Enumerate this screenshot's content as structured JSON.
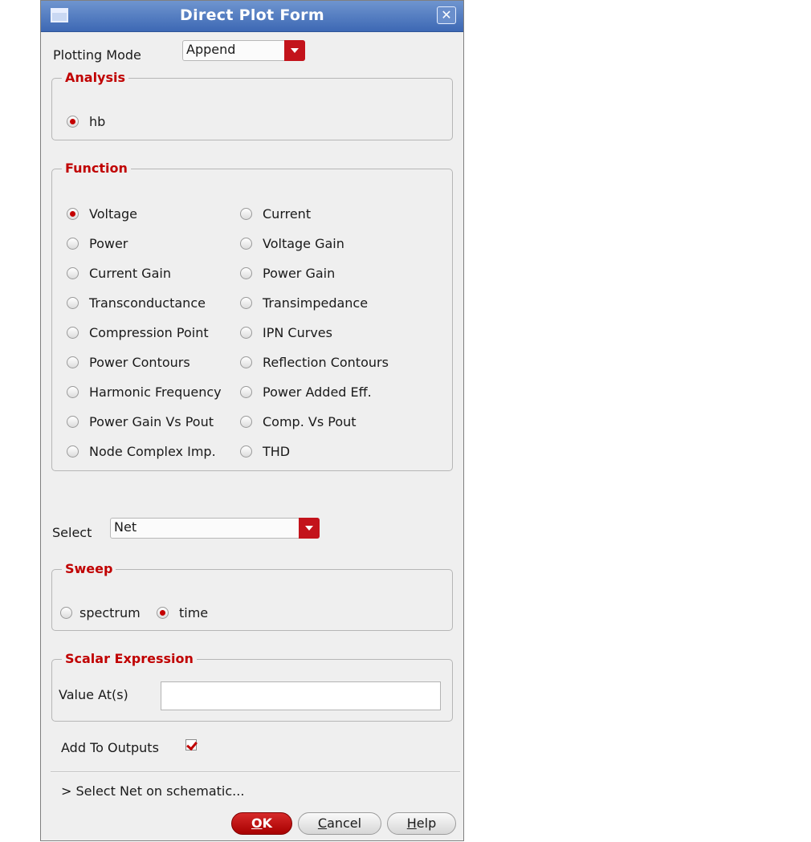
{
  "window": {
    "title": "Direct Plot Form",
    "close_glyph": "✕"
  },
  "plotting_mode": {
    "label": "Plotting Mode",
    "value": "Append"
  },
  "analysis": {
    "title": "Analysis",
    "options": [
      {
        "label": "hb",
        "selected": true
      }
    ]
  },
  "function": {
    "title": "Function",
    "options": [
      {
        "label": "Voltage",
        "selected": true
      },
      {
        "label": "Current",
        "selected": false
      },
      {
        "label": "Power",
        "selected": false
      },
      {
        "label": "Voltage Gain",
        "selected": false
      },
      {
        "label": "Current Gain",
        "selected": false
      },
      {
        "label": "Power Gain",
        "selected": false
      },
      {
        "label": "Transconductance",
        "selected": false
      },
      {
        "label": "Transimpedance",
        "selected": false
      },
      {
        "label": "Compression Point",
        "selected": false
      },
      {
        "label": "IPN Curves",
        "selected": false
      },
      {
        "label": "Power Contours",
        "selected": false
      },
      {
        "label": "Reflection Contours",
        "selected": false
      },
      {
        "label": "Harmonic Frequency",
        "selected": false
      },
      {
        "label": "Power Added Eff.",
        "selected": false
      },
      {
        "label": "Power Gain Vs Pout",
        "selected": false
      },
      {
        "label": "Comp. Vs Pout",
        "selected": false
      },
      {
        "label": "Node Complex Imp.",
        "selected": false
      },
      {
        "label": "THD",
        "selected": false
      }
    ]
  },
  "select": {
    "label": "Select",
    "value": "Net"
  },
  "sweep": {
    "title": "Sweep",
    "options": [
      {
        "label": "spectrum",
        "selected": false
      },
      {
        "label": "time",
        "selected": true
      }
    ]
  },
  "scalar_expression": {
    "title": "Scalar Expression",
    "value_label": "Value At(s)",
    "value": ""
  },
  "add_to_outputs": {
    "label": "Add To Outputs",
    "checked": true
  },
  "status": {
    "text": "> Select Net on schematic..."
  },
  "buttons": {
    "ok": {
      "mnemonic": "O",
      "rest": "K"
    },
    "cancel": {
      "mnemonic": "C",
      "rest": "ancel"
    },
    "help": {
      "mnemonic": "H",
      "rest": "elp"
    }
  },
  "colors": {
    "accent": "#c40000",
    "titlebar": "#4a74bd",
    "window_bg": "#efefef"
  }
}
